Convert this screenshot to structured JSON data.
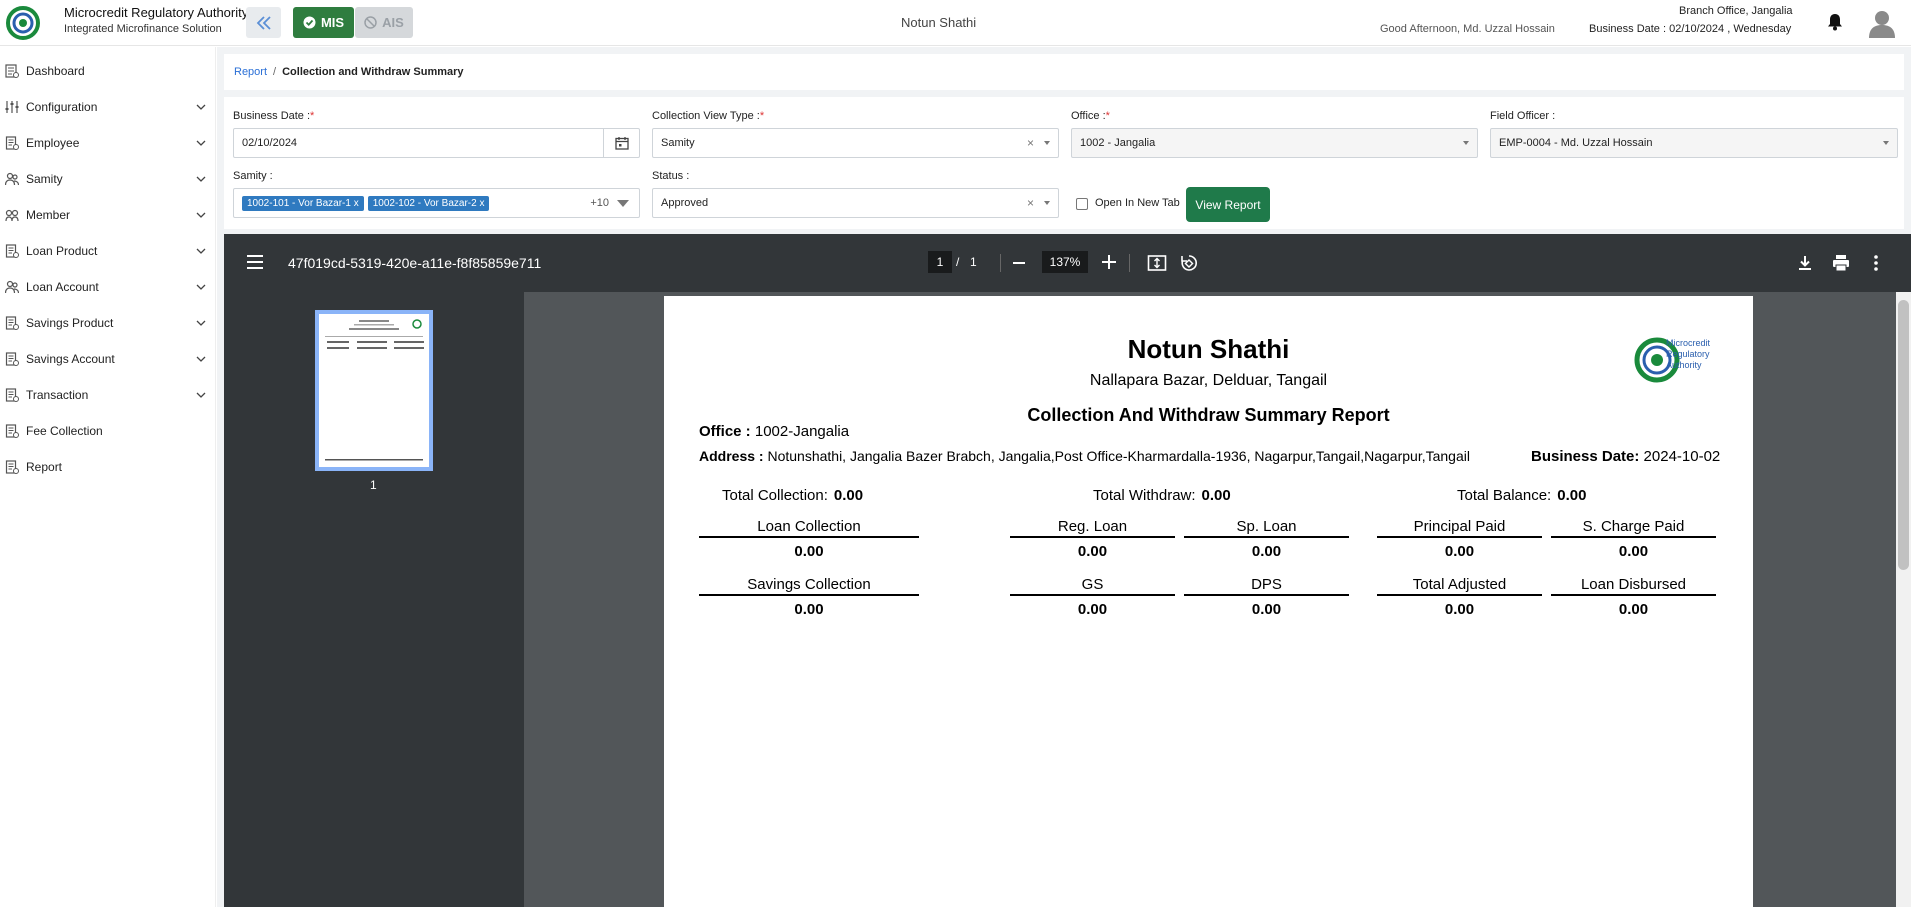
{
  "header": {
    "brand_title": "Microcredit Regulatory Authority",
    "brand_subtitle": "Integrated Microfinance Solution",
    "logo_text": "Microcredit Regulatory Authority",
    "mis_label": "MIS",
    "ais_label": "AIS",
    "org_name": "Notun Shathi",
    "greeting": "Good Afternoon, Md. Uzzal Hossain",
    "branch": "Branch Office, Jangalia",
    "business_date": "Business Date : 02/10/2024 , Wednesday",
    "colors": {
      "mis_green": "#2f7d3f",
      "view_green": "#1f7a4a",
      "link_blue": "#2a6fd6"
    }
  },
  "sidebar": {
    "items": [
      {
        "label": "Dashboard",
        "icon": "dashboard-icon",
        "has_children": false
      },
      {
        "label": "Configuration",
        "icon": "sliders-icon",
        "has_children": true
      },
      {
        "label": "Employee",
        "icon": "document-icon",
        "has_children": true
      },
      {
        "label": "Samity",
        "icon": "group-icon",
        "has_children": true
      },
      {
        "label": "Member",
        "icon": "members-icon",
        "has_children": true
      },
      {
        "label": "Loan Product",
        "icon": "document-icon",
        "has_children": true
      },
      {
        "label": "Loan Account",
        "icon": "group-icon",
        "has_children": true
      },
      {
        "label": "Savings Product",
        "icon": "document-icon",
        "has_children": true
      },
      {
        "label": "Savings Account",
        "icon": "document-icon",
        "has_children": true
      },
      {
        "label": "Transaction",
        "icon": "document-icon",
        "has_children": true
      },
      {
        "label": "Fee Collection",
        "icon": "document-icon",
        "has_children": false
      },
      {
        "label": "Report",
        "icon": "document-icon",
        "has_children": false
      }
    ]
  },
  "breadcrumb": {
    "parent": "Report",
    "separator": "/",
    "current": "Collection and Withdraw Summary"
  },
  "filters": {
    "business_date": {
      "label": "Business Date :",
      "value": "02/10/2024"
    },
    "collection_view_type": {
      "label": "Collection View Type :",
      "value": "Samity"
    },
    "office": {
      "label": "Office :",
      "value": "1002 - Jangalia"
    },
    "field_officer": {
      "label": "Field Officer :",
      "value": "EMP-0004 - Md. Uzzal Hossain"
    },
    "samity": {
      "label": "Samity :",
      "tags": [
        "1002-101 - Vor Bazar-1",
        "1002-102 - Vor Bazar-2"
      ],
      "more": "+10"
    },
    "status": {
      "label": "Status :",
      "value": "Approved"
    },
    "open_new_tab": "Open In New Tab",
    "view_report": "View Report",
    "required_mark": "*",
    "clear_symbol": "×",
    "tag_remove": "x"
  },
  "pdf_viewer": {
    "file_name": "47f019cd-5319-420e-a11e-f8f85859e711",
    "current_page": "1",
    "page_separator": "/",
    "total_pages": "1",
    "zoom": "137%",
    "thumbnail_page": "1"
  },
  "report": {
    "org_name": "Notun Shathi",
    "org_address": "Nallapara Bazar, Delduar, Tangail",
    "title": "Collection And Withdraw Summary Report",
    "office_label": "Office :",
    "office_value": "1002-Jangalia",
    "address_label": "Address :",
    "address_value": "Notunshathi, Jangalia Bazer Brabch, Jangalia,Post Office-Kharmardalla-1936, Nagarpur,Tangail,Nagarpur,Tangail",
    "business_date_label": "Business Date:",
    "business_date_value": "2024-10-02",
    "logo_text": [
      "Microcredit",
      "Regulatory",
      "Authority"
    ],
    "totals": [
      {
        "label": "Total Collection:",
        "value": "0.00"
      },
      {
        "label": "Total Withdraw:",
        "value": "0.00"
      },
      {
        "label": "Total Balance:",
        "value": "0.00"
      }
    ],
    "metrics_row1": [
      {
        "label": "Loan Collection",
        "value": "0.00"
      },
      {
        "label": "Reg. Loan",
        "value": "0.00"
      },
      {
        "label": "Sp. Loan",
        "value": "0.00"
      },
      {
        "label": "Principal Paid",
        "value": "0.00"
      },
      {
        "label": "S. Charge Paid",
        "value": "0.00"
      }
    ],
    "metrics_row2": [
      {
        "label": "Savings Collection",
        "value": "0.00"
      },
      {
        "label": "GS",
        "value": "0.00"
      },
      {
        "label": "DPS",
        "value": "0.00"
      },
      {
        "label": "Total Adjusted",
        "value": "0.00"
      },
      {
        "label": "Loan Disbursed",
        "value": "0.00"
      }
    ]
  }
}
